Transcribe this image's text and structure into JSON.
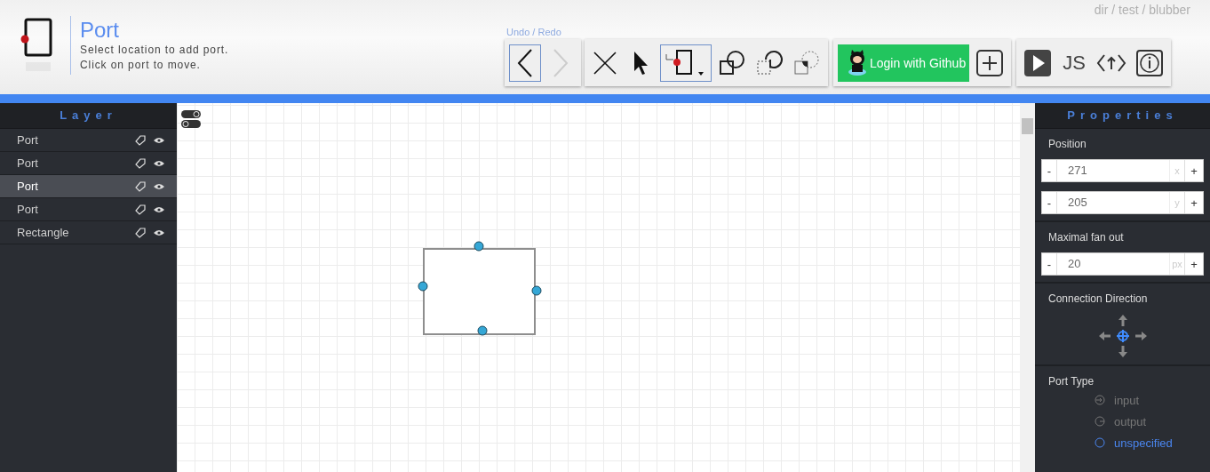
{
  "header": {
    "title": "Port",
    "hints": [
      "Select location to add port.",
      "Click on port to move."
    ],
    "breadcrumb": "dir / test / blubber",
    "undo_label": "Undo / Redo"
  },
  "toolbar": {
    "history": [
      {
        "kind": "back",
        "selected": true,
        "disabled": false
      },
      {
        "kind": "forward",
        "selected": false,
        "disabled": true
      }
    ],
    "tools": [
      {
        "kind": "delete",
        "selected": false
      },
      {
        "kind": "select",
        "selected": false
      },
      {
        "kind": "port",
        "selected": true
      },
      {
        "kind": "union",
        "selected": false
      },
      {
        "kind": "difference",
        "selected": false
      },
      {
        "kind": "intersection",
        "selected": false
      }
    ],
    "login": {
      "label": "Login with Github"
    },
    "run": {
      "js": "JS"
    }
  },
  "layers": {
    "title": "Layer",
    "items": [
      {
        "name": "Port",
        "selected": false
      },
      {
        "name": "Port",
        "selected": false
      },
      {
        "name": "Port",
        "selected": true
      },
      {
        "name": "Port",
        "selected": false
      },
      {
        "name": "Rectangle",
        "selected": false
      }
    ]
  },
  "properties": {
    "title": "Properties",
    "position": {
      "label": "Position",
      "fields": [
        {
          "minus": "-",
          "value": "271",
          "unit": "x",
          "plus": "+"
        },
        {
          "minus": "-",
          "value": "205",
          "unit": "y",
          "plus": "+"
        }
      ]
    },
    "fan_out": {
      "label": "Maximal fan out",
      "field": {
        "minus": "-",
        "value": "20",
        "unit": "px",
        "plus": "+"
      }
    },
    "direction": {
      "label": "Connection Direction"
    },
    "port_type": {
      "label": "Port Type",
      "options": [
        {
          "kind": "input",
          "label": "input",
          "selected": false
        },
        {
          "kind": "output",
          "label": "output",
          "selected": false
        },
        {
          "kind": "unspecified",
          "label": "unspecified",
          "selected": true
        }
      ]
    }
  }
}
